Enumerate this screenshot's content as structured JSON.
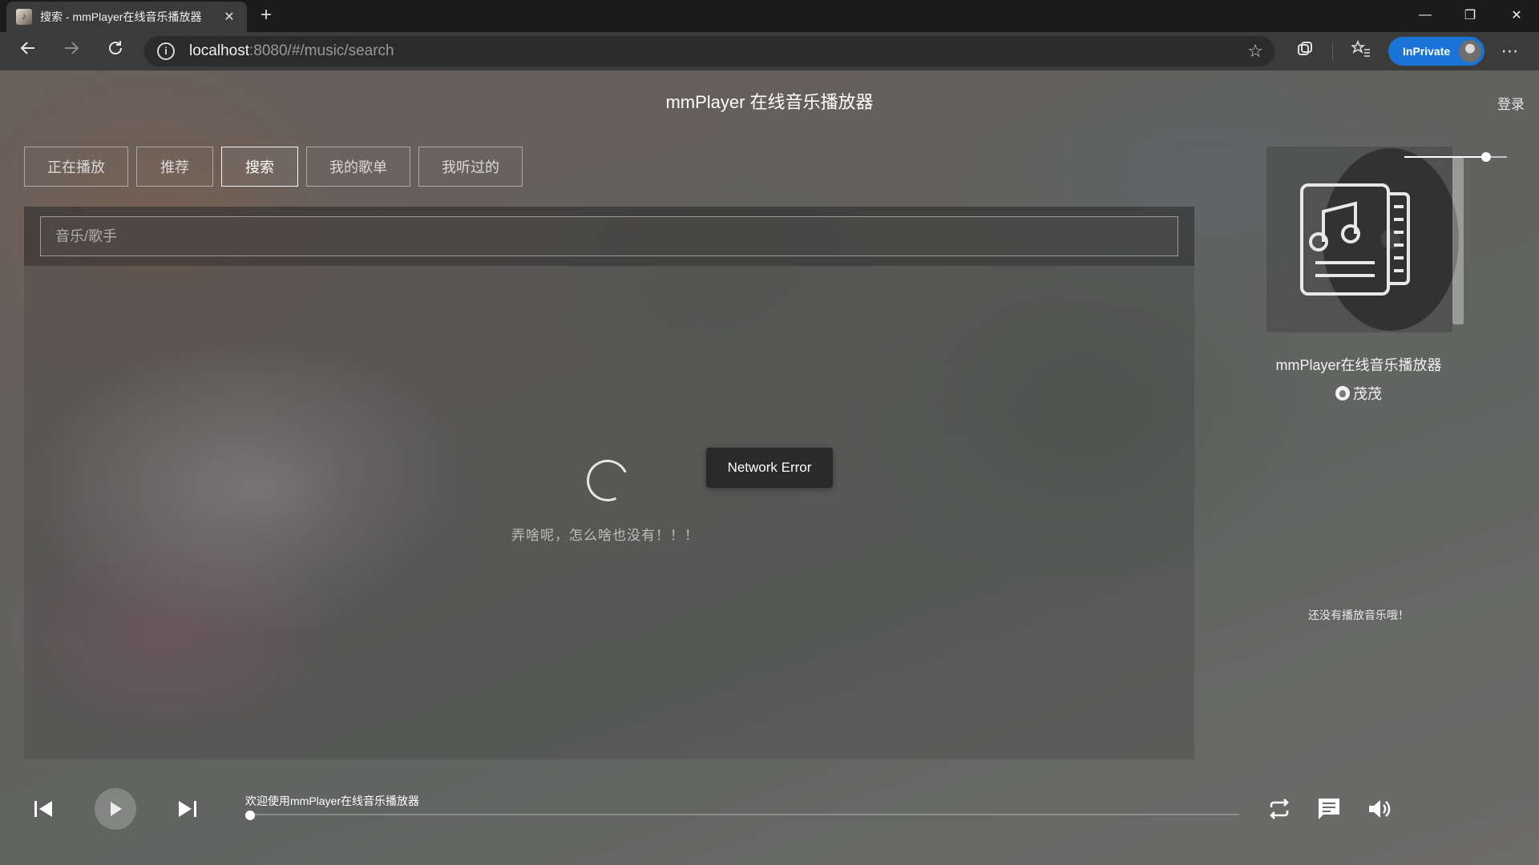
{
  "browser": {
    "tab_title": "搜索 - mmPlayer在线音乐播放器",
    "new_tab": "+",
    "url_host": "localhost",
    "url_path": ":8080/#/music/search",
    "inprivate_label": "InPrivate"
  },
  "header": {
    "title": "mmPlayer 在线音乐播放器",
    "login": "登录"
  },
  "nav": {
    "tabs": [
      {
        "label": "正在播放",
        "active": false
      },
      {
        "label": "推荐",
        "active": false
      },
      {
        "label": "搜索",
        "active": true
      },
      {
        "label": "我的歌单",
        "active": false
      },
      {
        "label": "我听过的",
        "active": false
      }
    ]
  },
  "search": {
    "placeholder": "音乐/歌手",
    "value": "",
    "empty_text": "弄啥呢，怎么啥也没有！！！"
  },
  "toast": {
    "message": "Network Error"
  },
  "sidebar": {
    "song_name": "mmPlayer在线音乐播放器",
    "author": "茂茂",
    "lyric_empty": "还没有播放音乐哦！"
  },
  "player": {
    "now_playing": "欢迎使用mmPlayer在线音乐播放器",
    "progress": 0,
    "volume": 0.8
  },
  "icons": {
    "back": "arrow-left-icon",
    "forward": "arrow-right-icon",
    "reload": "reload-icon",
    "info": "info-icon",
    "favorite": "star-icon",
    "collections": "collections-icon",
    "favorites_bar": "favorites-icon",
    "more": "more-icon",
    "prev": "skip-previous-icon",
    "play": "play-icon",
    "next": "skip-next-icon",
    "mode": "repeat-icon",
    "lyric": "comment-icon",
    "volume": "volume-icon",
    "github": "github-icon",
    "cover": "music-note-document-icon"
  }
}
